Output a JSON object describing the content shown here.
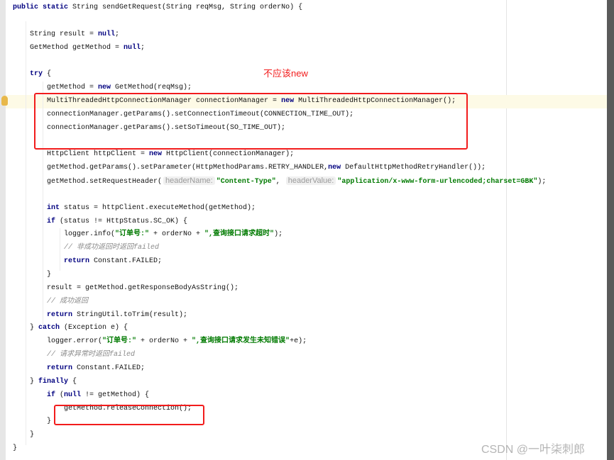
{
  "annotation": {
    "text": "不应该new",
    "color": "#f21c1c"
  },
  "watermark": "CSDN @一叶柒刺郎",
  "code": [
    {
      "indent": 0,
      "tokens": [
        [
          "kw",
          "public static "
        ],
        [
          "p",
          "String sendGetRequest(String reqMsg, String orderNo) {"
        ]
      ]
    },
    {
      "indent": 0,
      "tokens": []
    },
    {
      "indent": 1,
      "tokens": [
        [
          "p",
          "String result = "
        ],
        [
          "kw",
          "null"
        ],
        [
          "p",
          ";"
        ]
      ]
    },
    {
      "indent": 1,
      "tokens": [
        [
          "p",
          "GetMethod getMethod = "
        ],
        [
          "kw",
          "null"
        ],
        [
          "p",
          ";"
        ]
      ]
    },
    {
      "indent": 0,
      "tokens": []
    },
    {
      "indent": 1,
      "tokens": [
        [
          "kw",
          "try"
        ],
        [
          "p",
          " {"
        ]
      ]
    },
    {
      "indent": 2,
      "tokens": [
        [
          "p",
          "getMethod = "
        ],
        [
          "kw",
          "new"
        ],
        [
          "p",
          " GetMethod(reqMsg);"
        ]
      ]
    },
    {
      "indent": 2,
      "tokens": [
        [
          "p",
          "MultiThreadedHttpConnectionManager connectionManager = "
        ],
        [
          "kw",
          "new"
        ],
        [
          "p",
          " MultiThreadedHttpConnectionManager();"
        ]
      ]
    },
    {
      "indent": 2,
      "tokens": [
        [
          "p",
          "connectionManager.getParams().setConnectionTimeout(CONNECTION_TIME_OUT);"
        ]
      ]
    },
    {
      "indent": 2,
      "tokens": [
        [
          "p",
          "connectionManager.getParams().setSoTimeout(SO_TIME_OUT);"
        ]
      ]
    },
    {
      "indent": 0,
      "tokens": []
    },
    {
      "indent": 2,
      "tokens": [
        [
          "p",
          "HttpClient httpClient = "
        ],
        [
          "kw",
          "new"
        ],
        [
          "p",
          " HttpClient(connectionManager);"
        ]
      ]
    },
    {
      "indent": 2,
      "tokens": [
        [
          "p",
          "getMethod.getParams().setParameter(HttpMethodParams.RETRY_HANDLER,"
        ],
        [
          "kw",
          "new"
        ],
        [
          "p",
          " DefaultHttpMethodRetryHandler());"
        ]
      ]
    },
    {
      "indent": 2,
      "tokens": [
        [
          "p",
          "getMethod.setRequestHeader("
        ],
        [
          "hint",
          "headerName:"
        ],
        [
          "str",
          "\"Content-Type\""
        ],
        [
          "p",
          ", "
        ],
        [
          "hint",
          "headerValue:"
        ],
        [
          "str",
          "\"application/x-www-form-urlencoded;charset=GBK\""
        ],
        [
          "p",
          ");"
        ]
      ]
    },
    {
      "indent": 0,
      "tokens": []
    },
    {
      "indent": 2,
      "tokens": [
        [
          "kw",
          "int"
        ],
        [
          "p",
          " status = httpClient.executeMethod(getMethod);"
        ]
      ]
    },
    {
      "indent": 2,
      "tokens": [
        [
          "kw",
          "if"
        ],
        [
          "p",
          " (status != HttpStatus.SC_OK) {"
        ]
      ]
    },
    {
      "indent": 3,
      "tokens": [
        [
          "p",
          "logger.info("
        ],
        [
          "str",
          "\"订单号:\""
        ],
        [
          "p",
          " + orderNo + "
        ],
        [
          "str",
          "\",查询接口请求超时\""
        ],
        [
          "p",
          ");"
        ]
      ]
    },
    {
      "indent": 3,
      "tokens": [
        [
          "cm",
          "// 非成功返回时返回failed"
        ]
      ]
    },
    {
      "indent": 3,
      "tokens": [
        [
          "kw",
          "return"
        ],
        [
          "p",
          " Constant.FAILED;"
        ]
      ]
    },
    {
      "indent": 2,
      "tokens": [
        [
          "p",
          "}"
        ]
      ]
    },
    {
      "indent": 2,
      "tokens": [
        [
          "p",
          "result = getMethod.getResponseBodyAsString();"
        ]
      ]
    },
    {
      "indent": 2,
      "tokens": [
        [
          "cm",
          "// 成功返回"
        ]
      ]
    },
    {
      "indent": 2,
      "tokens": [
        [
          "kw",
          "return"
        ],
        [
          "p",
          " StringUtil.toTrim(result);"
        ]
      ]
    },
    {
      "indent": 1,
      "tokens": [
        [
          "p",
          "} "
        ],
        [
          "kw",
          "catch"
        ],
        [
          "p",
          " (Exception e) {"
        ]
      ]
    },
    {
      "indent": 2,
      "tokens": [
        [
          "p",
          "logger.error("
        ],
        [
          "str",
          "\"订单号:\""
        ],
        [
          "p",
          " + orderNo + "
        ],
        [
          "str",
          "\",查询接口请求发生未知错误\""
        ],
        [
          "p",
          "+e);"
        ]
      ]
    },
    {
      "indent": 2,
      "tokens": [
        [
          "cm",
          "// 请求异常时返回failed"
        ]
      ]
    },
    {
      "indent": 2,
      "tokens": [
        [
          "kw",
          "return"
        ],
        [
          "p",
          " Constant.FAILED;"
        ]
      ]
    },
    {
      "indent": 1,
      "tokens": [
        [
          "p",
          "} "
        ],
        [
          "kw",
          "finally"
        ],
        [
          "p",
          " {"
        ]
      ]
    },
    {
      "indent": 2,
      "tokens": [
        [
          "kw",
          "if"
        ],
        [
          "p",
          " ("
        ],
        [
          "kw",
          "null"
        ],
        [
          "p",
          " != getMethod) {"
        ]
      ]
    },
    {
      "indent": 3,
      "tokens": [
        [
          "p",
          "getMethod.releaseConnection();"
        ]
      ]
    },
    {
      "indent": 2,
      "tokens": [
        [
          "p",
          "}"
        ]
      ]
    },
    {
      "indent": 1,
      "tokens": [
        [
          "p",
          "}"
        ]
      ]
    },
    {
      "indent": 0,
      "tokens": [
        [
          "p",
          "}"
        ]
      ]
    }
  ]
}
